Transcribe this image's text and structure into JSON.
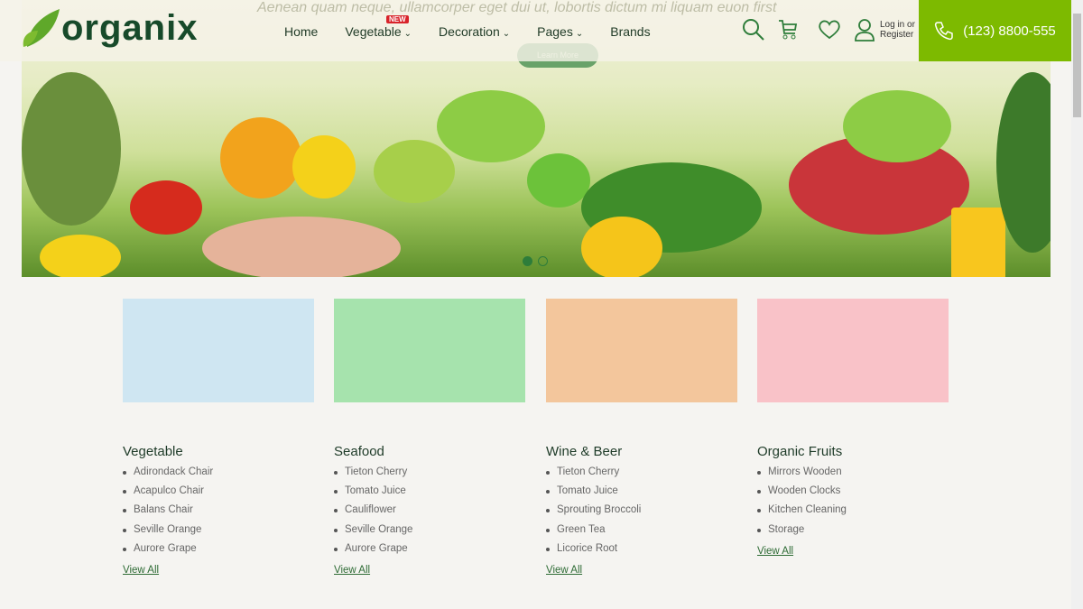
{
  "header": {
    "logo": "organix",
    "nav": [
      {
        "label": "Home"
      },
      {
        "label": "Vegetable",
        "badge": "NEW",
        "dropdown": true
      },
      {
        "label": "Decoration",
        "dropdown": true
      },
      {
        "label": "Pages",
        "dropdown": true
      },
      {
        "label": "Brands"
      }
    ],
    "login": "Log in",
    "or": "or",
    "register": "Register",
    "phone": "(123) 8800-555"
  },
  "hero": {
    "subtitle": "Aenean quam neque, ullamcorper eget dui ut, lobortis dictum mi liquam euon first",
    "button": "Learn More",
    "slides": 2,
    "active_slide": 1
  },
  "categories": [
    {
      "title": "Vegetable",
      "bg": "#cfe6f2",
      "items": [
        "Adirondack Chair",
        "Acapulco Chair",
        "Balans Chair",
        "Seville Orange",
        "Aurore Grape"
      ],
      "link": "View All"
    },
    {
      "title": "Seafood",
      "bg": "#a6e3ad",
      "items": [
        "Tieton Cherry",
        "Tomato Juice",
        "Cauliflower",
        "Seville Orange",
        "Aurore Grape"
      ],
      "link": "View All"
    },
    {
      "title": "Wine & Beer",
      "bg": "#f3c69c",
      "items": [
        "Tieton Cherry",
        "Tomato Juice",
        "Sprouting Broccoli",
        "Green Tea",
        "Licorice Root"
      ],
      "link": "View All"
    },
    {
      "title": "Organic Fruits",
      "bg": "#f9c2c8",
      "items": [
        "Mirrors Wooden",
        "Wooden Clocks",
        "Kitchen Cleaning",
        "Storage"
      ],
      "link": "View All"
    }
  ]
}
